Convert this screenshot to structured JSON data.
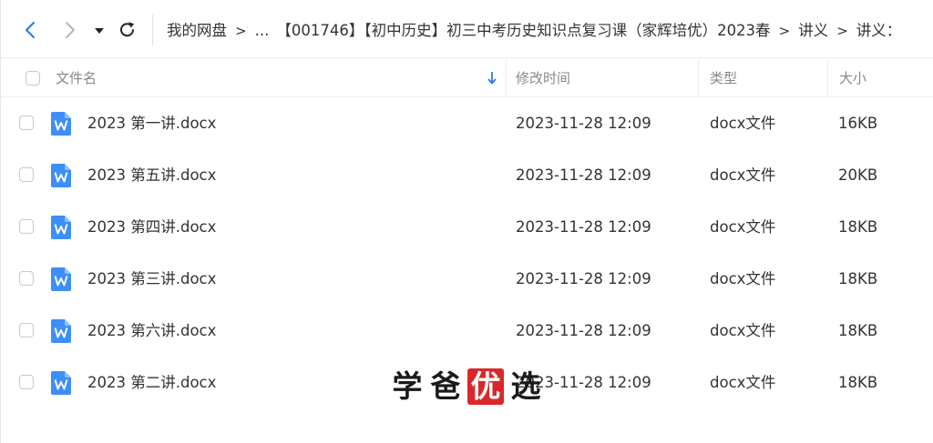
{
  "toolbar": {
    "icons": {
      "back": "chevron-left-icon",
      "forward": "chevron-right-icon",
      "history": "caret-down-icon",
      "refresh": "refresh-icon"
    },
    "accent_color": "#2b7de9"
  },
  "breadcrumb": {
    "root": "我的网盘",
    "ellipsis": "...",
    "folder": "【001746】【初中历史】初三中考历史知识点复习课（家辉培优）2023春",
    "sub1": "讲义",
    "sub2": "讲义：",
    "separator": ">"
  },
  "table": {
    "columns": {
      "name": "文件名",
      "modified": "修改时间",
      "type": "类型",
      "size": "大小"
    },
    "sort_icon": "arrow-down-icon",
    "rows": [
      {
        "name": "2023 第一讲.docx",
        "modified": "2023-11-28 12:09",
        "type": "docx文件",
        "size": "16KB",
        "icon": "word-doc-icon"
      },
      {
        "name": "2023 第五讲.docx",
        "modified": "2023-11-28 12:09",
        "type": "docx文件",
        "size": "20KB",
        "icon": "word-doc-icon"
      },
      {
        "name": "2023 第四讲.docx",
        "modified": "2023-11-28 12:09",
        "type": "docx文件",
        "size": "18KB",
        "icon": "word-doc-icon"
      },
      {
        "name": "2023 第三讲.docx",
        "modified": "2023-11-28 12:09",
        "type": "docx文件",
        "size": "18KB",
        "icon": "word-doc-icon"
      },
      {
        "name": "2023 第六讲.docx",
        "modified": "2023-11-28 12:09",
        "type": "docx文件",
        "size": "18KB",
        "icon": "word-doc-icon"
      },
      {
        "name": "2023 第二讲.docx",
        "modified": "2023-11-28 12:09",
        "type": "docx文件",
        "size": "18KB",
        "icon": "word-doc-icon"
      }
    ]
  },
  "watermark": {
    "chars": [
      "学",
      "爸",
      "优",
      "选"
    ],
    "seal_color": "#d8282c"
  }
}
